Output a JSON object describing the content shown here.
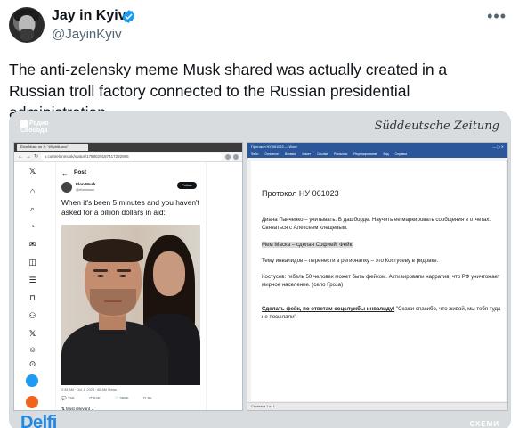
{
  "tweet": {
    "author_name": "Jay in Kyiv",
    "author_handle": "@JayinKyiv",
    "more_icon": "more-horizontal-icon",
    "verified_icon": "verified-badge-icon",
    "verified_color": "#1d9bf0",
    "text": "The anti-zelensky meme Musk shared was actually created in a Russian troll factory connected to the Russian presidential administration."
  },
  "media": {
    "svoboda_logo": "Радио Свобода",
    "sz_logo": "Süddeutsche Zeitung",
    "footer_left_logo": "Delfi",
    "footer_right_logo": "СХЕМИ",
    "browser": {
      "tab_title": "Elon Musk on X: \"#SpiritUnco\"",
      "url": "x.com/elonmusk/status/1788029187417292985",
      "post_header": "Post",
      "post_author": "Elon Musk",
      "post_handle": "@elonmusk",
      "follow_label": "Follow",
      "meme_text": "When it's been 5 minutes and you haven't asked for a billion dollars in aid:",
      "meta": "2:45 AM · Oct 1, 2023 · 86.6M Views",
      "actions": [
        "25K",
        "84K",
        "398K",
        "9K"
      ],
      "reply_prompt": "Most relevant"
    },
    "word": {
      "window_title": "Протокол НУ 061023 — Word",
      "menu": [
        "Файл",
        "Основное",
        "Вставка",
        "Макет",
        "Ссылки",
        "Рассылки",
        "Рецензирование",
        "Вид",
        "Справка"
      ],
      "doc_title": "Протокол НУ 061023",
      "para1": "Диана Панченко – учитывать. В дашборде. Научить ее маркировать сообщения в отчетах. Связаться с Алексеем клещевым.",
      "para2": "Мем Маска – сделан Софией. Фейк.",
      "para3": "Тему инвалидов – перенести в регионалку – это Костусеву в ридовке.",
      "para4": "Костусев: гибель 50 человек может быть фейком. Активировали нарратив, что РФ уничтожает мирное население. (село Гроза)",
      "para5_bold": "Сделать фейк, по ответам соцслужбы инвалиду!",
      "para5_rest": " \"Скажи спасибо, что живой, мы тебя туда не посылали\"",
      "status": "Страница 1 из 1"
    }
  }
}
